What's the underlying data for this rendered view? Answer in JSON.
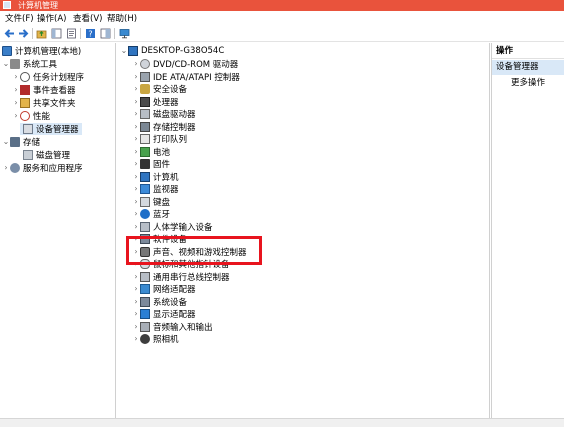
{
  "window": {
    "title": "计算机管理"
  },
  "menu": {
    "file": "文件(F)",
    "action": "操作(A)",
    "view": "查看(V)",
    "help": "帮助(H)"
  },
  "left_tree": {
    "root": "计算机管理(本地)",
    "system_tools": "系统工具",
    "task_scheduler": "任务计划程序",
    "event_viewer": "事件查看器",
    "shared_folders": "共享文件夹",
    "performance": "性能",
    "device_manager": "设备管理器",
    "storage": "存储",
    "disk_management": "磁盘管理",
    "services_apps": "服务和应用程序"
  },
  "device_tree": {
    "root": "DESKTOP-G38O54C",
    "items": [
      "DVD/CD-ROM 驱动器",
      "IDE ATA/ATAPI 控制器",
      "安全设备",
      "处理器",
      "磁盘驱动器",
      "存储控制器",
      "打印队列",
      "电池",
      "固件",
      "计算机",
      "监视器",
      "键盘",
      "蓝牙",
      "人体学输入设备",
      "软件设备",
      "声音、视频和游戏控制器",
      "鼠标和其他指针设备",
      "通用串行总线控制器",
      "网络适配器",
      "系统设备",
      "显示适配器",
      "音频输入和输出",
      "照相机"
    ]
  },
  "actions": {
    "header": "操作",
    "section": "设备管理器",
    "more": "更多操作"
  }
}
